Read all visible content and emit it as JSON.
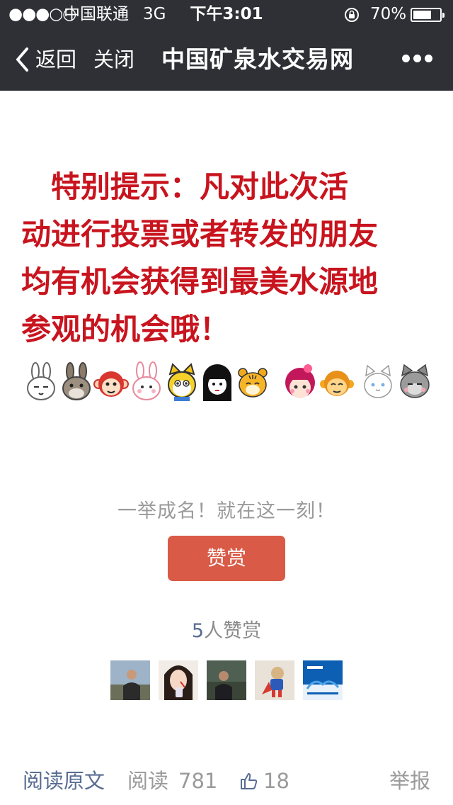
{
  "status_bar": {
    "signal": "●●●○○",
    "carrier": "中国联通",
    "network": "3G",
    "time": "下午3:01",
    "battery_percent": "70%",
    "battery_level": 0.7
  },
  "nav": {
    "back_label": "返回",
    "close_label": "关闭",
    "title": "中国矿泉水交易网"
  },
  "notice": {
    "color": "#c8141e",
    "lines": [
      "　特别提示：凡对此次活",
      "动进行投票或者转发的朋友",
      "均有机会获得到最美水源地",
      "参观的机会哦！"
    ]
  },
  "emojis": [
    "rabbit-icon",
    "donkey-icon",
    "monkey-icon",
    "pink-bunny-icon",
    "yellow-cat-icon",
    "black-hair-girl-icon",
    "tiger-icon",
    "pink-girl-icon",
    "orange-monkey-icon",
    "white-cat-icon",
    "grey-cat-icon"
  ],
  "reward": {
    "slogan": "一举成名！就在这一刻！",
    "button_label": "赞赏",
    "count": "5",
    "count_suffix": "人赞赏"
  },
  "avatars": [
    "avatar-man-outdoors",
    "avatar-woman-drinking",
    "avatar-man-in-suit",
    "avatar-toy-figure",
    "avatar-brand-logo"
  ],
  "footer": {
    "read_original": "阅读原文",
    "read_label": "阅读",
    "read_count": "781",
    "like_count": "18",
    "report_label": "举报"
  },
  "colors": {
    "topbar": "#2f3036",
    "link": "#586c92",
    "button": "#d95b47"
  }
}
